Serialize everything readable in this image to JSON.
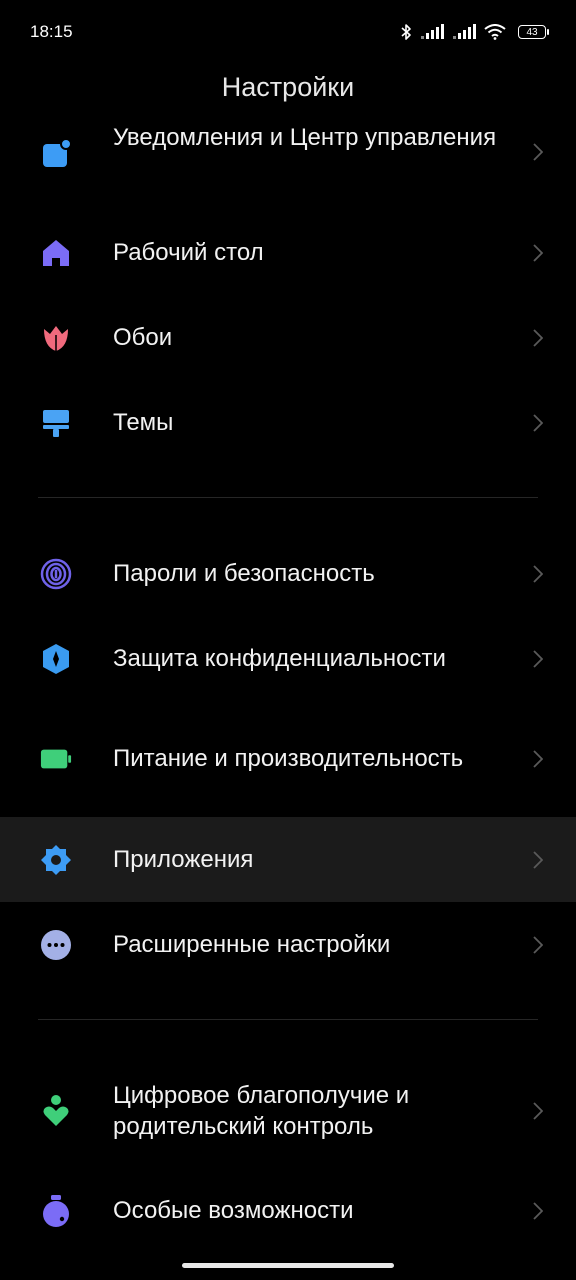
{
  "status_bar": {
    "time": "18:15",
    "battery_level": "43",
    "icons": [
      "bluetooth-icon",
      "signal-icon",
      "signal-icon",
      "wifi-icon",
      "battery-icon"
    ]
  },
  "header": {
    "title": "Настройки"
  },
  "settings": [
    {
      "label": "Уведомления и Центр управления",
      "icon": "notifications-icon",
      "color": "#3d9cf5"
    },
    {
      "label": "Рабочий стол",
      "icon": "home-icon",
      "color": "#7b6cf6"
    },
    {
      "label": "Обои",
      "icon": "wallpaper-tulip-icon",
      "color": "#f06a7d"
    },
    {
      "label": "Темы",
      "icon": "themes-brush-icon",
      "color": "#4aa3f4"
    },
    {
      "label": "Пароли и безопасность",
      "icon": "fingerprint-icon",
      "color": "#6f62e8"
    },
    {
      "label": "Защита конфиденциальности",
      "icon": "privacy-shield-icon",
      "color": "#3a9bf0"
    },
    {
      "label": "Питание и производительность",
      "icon": "battery-power-icon",
      "color": "#3fcf7a"
    },
    {
      "label": "Приложения",
      "icon": "apps-gear-icon",
      "color": "#3d9cf5"
    },
    {
      "label": "Расширенные настройки",
      "icon": "more-dots-icon",
      "color": "#a3b0e6"
    },
    {
      "label": "Цифровое благополучие и родительский контроль",
      "icon": "wellbeing-icon",
      "color": "#3fcf7a"
    },
    {
      "label": "Особые возможности",
      "icon": "accessibility-icon",
      "color": "#7b6cf6"
    }
  ]
}
